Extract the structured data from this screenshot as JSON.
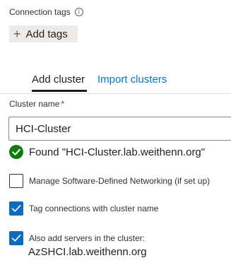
{
  "connection_tags": {
    "label": "Connection tags",
    "info_glyph": "i",
    "add_button_label": "Add tags",
    "add_button_glyph": "+"
  },
  "tabs": [
    {
      "label": "Add cluster",
      "selected": true
    },
    {
      "label": "Import clusters",
      "selected": false
    }
  ],
  "cluster_name": {
    "label": "Cluster name",
    "required_marker": "*",
    "value": "HCI-Cluster"
  },
  "status": {
    "icon": "check-circle-icon",
    "text": "Found \"HCI-Cluster.lab.weithenn.org\""
  },
  "options": {
    "sdn": {
      "label": "Manage Software-Defined Networking (if set up)",
      "checked": false
    },
    "tag_connections": {
      "label": "Tag connections with cluster name",
      "checked": true
    },
    "add_servers": {
      "label": "Also add servers in the cluster:",
      "checked": true
    }
  },
  "servers_value": "AzSHCI.lab.weithenn.org",
  "colors": {
    "accent": "#0f6cbd",
    "link": "#0078d4",
    "success": "#107c10",
    "required": "#a4262c"
  }
}
